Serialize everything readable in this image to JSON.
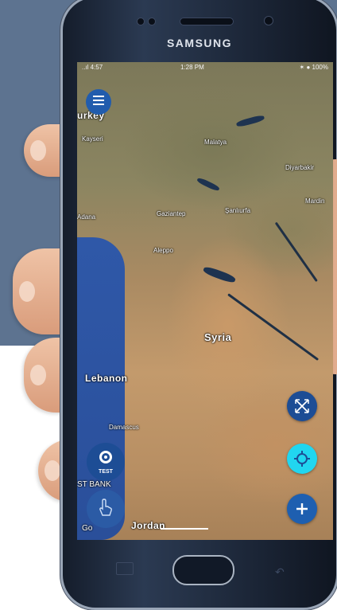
{
  "device": {
    "brand": "SAMSUNG"
  },
  "statusbar": {
    "left": "..ıl 4:57",
    "center": "1:28 PM",
    "right": "✶ ● 100%"
  },
  "map": {
    "labels": {
      "turkey": "urkey",
      "kayseri": "Kayseri",
      "malatya": "Malatya",
      "diyarbakir": "Diyarbakir",
      "mardin": "Mardin",
      "adana": "Adana",
      "gaziantep": "Gaziantep",
      "sanliurfa": "Şanlıurfa",
      "aleppo": "Aleppo",
      "syria": "Syria",
      "lebanon": "Lebanon",
      "damascus": "Damascus",
      "west_bank": "ST BANK",
      "jordan": "Jordan",
      "google": "Go"
    }
  },
  "buttons": {
    "test_label": "TEST",
    "colors": {
      "primary": "#1d4d95",
      "locate": "#21d6f0",
      "add": "#1e5fb0"
    }
  },
  "icons": {
    "menu": "hamburger-menu-icon",
    "test": "target-badge-icon",
    "touch": "touch-hand-icon",
    "compass": "compass-arrows-icon",
    "locate": "crosshair-locate-icon",
    "add": "plus-icon"
  }
}
